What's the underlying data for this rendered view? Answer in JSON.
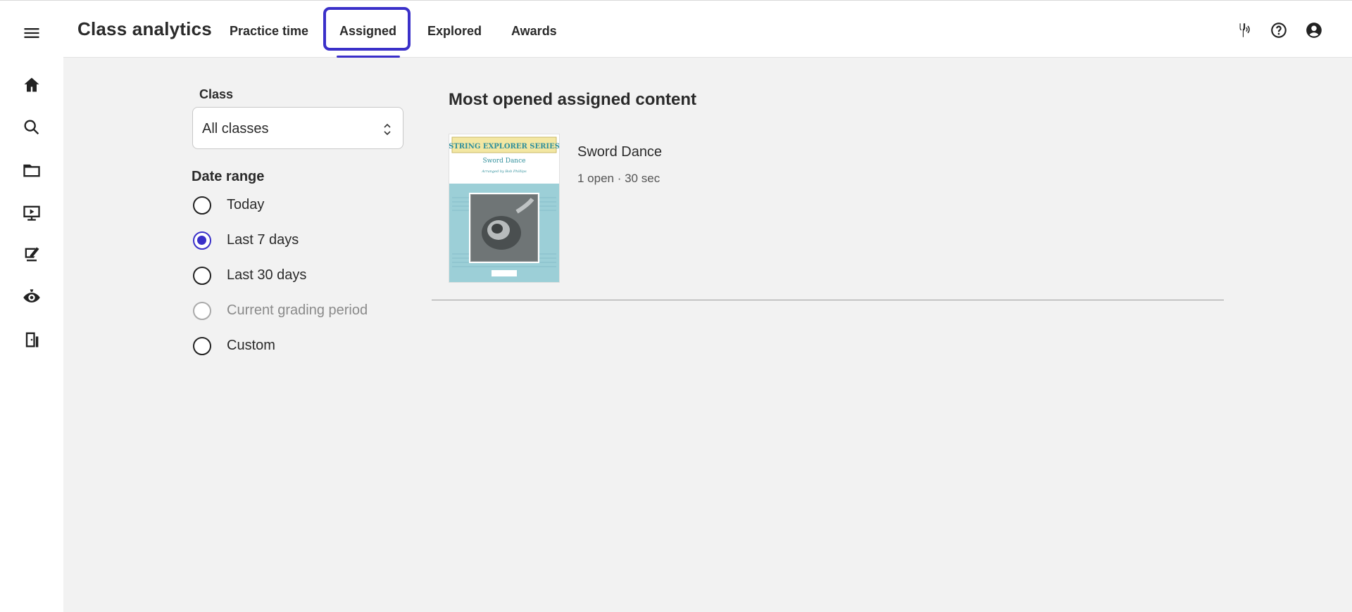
{
  "header": {
    "title": "Class analytics",
    "tabs": [
      {
        "label": "Practice time",
        "selected": false
      },
      {
        "label": "Assigned",
        "selected": true
      },
      {
        "label": "Explored",
        "selected": false
      },
      {
        "label": "Awards",
        "selected": false
      }
    ],
    "actions": [
      "tuner-icon",
      "help-icon",
      "account-icon"
    ]
  },
  "rail": {
    "items": [
      "menu-icon",
      "home-icon",
      "search-icon",
      "folder-icon",
      "video-icon",
      "assignment-icon",
      "ear-icon",
      "logout-icon"
    ]
  },
  "filters": {
    "class_label": "Class",
    "class_value": "All classes",
    "date_label": "Date range",
    "date_options": [
      {
        "label": "Today",
        "checked": false,
        "disabled": false
      },
      {
        "label": "Last 7 days",
        "checked": true,
        "disabled": false
      },
      {
        "label": "Last 30 days",
        "checked": false,
        "disabled": false
      },
      {
        "label": "Current grading period",
        "checked": false,
        "disabled": true
      },
      {
        "label": "Custom",
        "checked": false,
        "disabled": false
      }
    ]
  },
  "main": {
    "section_title": "Most opened assigned content",
    "items": [
      {
        "title": "Sword Dance",
        "meta": "1 open · 30 sec",
        "cover": {
          "series": "STRING EXPLORER SERIES",
          "title": "Sword Dance",
          "arranger": "Arranged by Bob Phillips"
        }
      }
    ]
  },
  "colors": {
    "accent": "#3a30c9",
    "background": "#f2f2f2",
    "surface": "#ffffff",
    "cover_blue": "#9ccfd7",
    "cover_yellow": "#f3e7a3"
  }
}
